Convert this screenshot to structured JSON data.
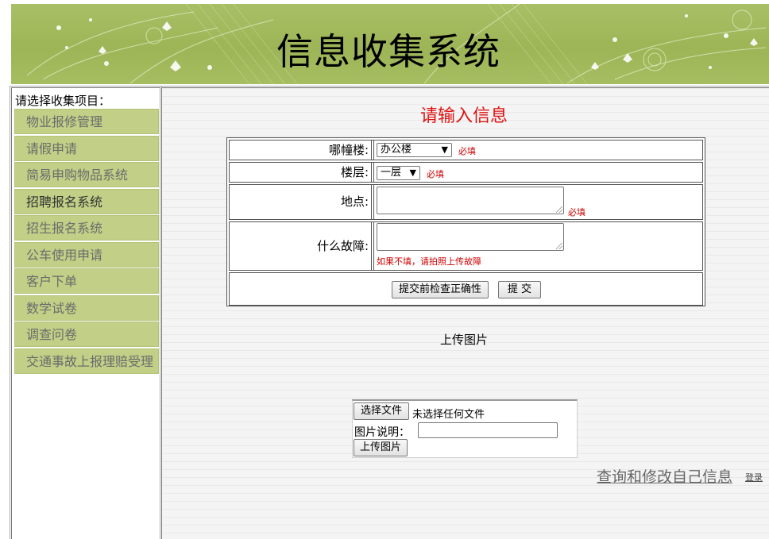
{
  "header": {
    "title": "信息收集系统"
  },
  "sidebar": {
    "heading": "请选择收集项目：",
    "items": [
      {
        "label": "物业报修管理"
      },
      {
        "label": "请假申请"
      },
      {
        "label": "简易申购物品系统"
      },
      {
        "label": "招聘报名系统"
      },
      {
        "label": "招生报名系统"
      },
      {
        "label": "公车使用申请"
      },
      {
        "label": "客户下单"
      },
      {
        "label": "数学试卷"
      },
      {
        "label": "调查问卷"
      },
      {
        "label": "交通事故上报理赔受理"
      }
    ]
  },
  "form": {
    "title": "请输入信息",
    "building_label": "哪幢楼:",
    "building_value": "办公楼",
    "floor_label": "楼层:",
    "floor_value": "一层",
    "location_label": "地点:",
    "fault_label": "什么故障:",
    "required_note": "必填",
    "fault_hint": "如果不填，请拍照上传故障",
    "check_button": "提交前检查正确性",
    "submit_button": "提 交"
  },
  "upload": {
    "heading": "上传图片",
    "choose_button": "选择文件",
    "no_file_text": "未选择任何文件",
    "caption_label": "图片说明：",
    "upload_button": "上传图片"
  },
  "links": {
    "query_modify": "查询和修改自己信息",
    "login": "登录"
  },
  "colors": {
    "banner": "#a3bb5e",
    "sidebar_item_bg": "#c2cf87",
    "title_red": "#e01010",
    "required_red": "#cc0000"
  }
}
